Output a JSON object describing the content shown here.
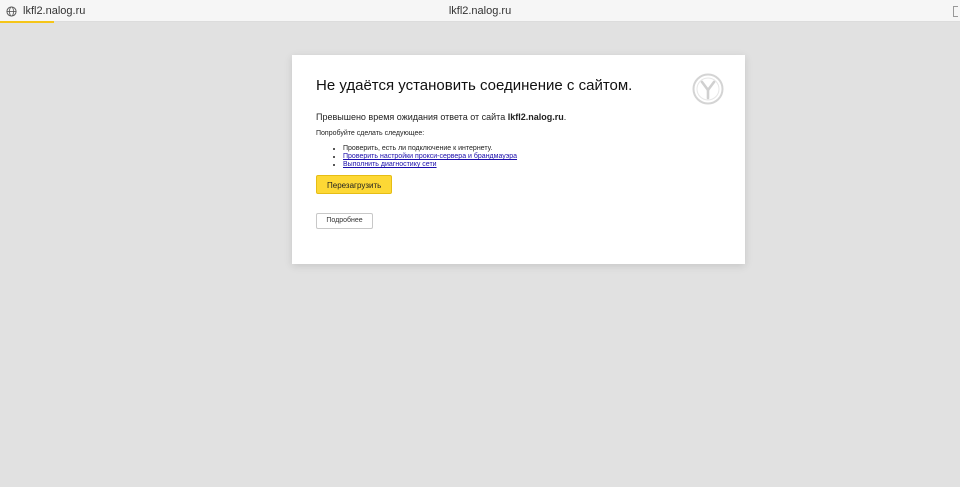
{
  "browser": {
    "tab_title": "lkfl2.nalog.ru",
    "page_title": "lkfl2.nalog.ru",
    "accent_color": "#f5c518"
  },
  "error": {
    "heading": "Не удаётся установить соединение с сайтом.",
    "message_prefix": "Превышено время ожидания ответа от сайта ",
    "host": "lkfl2.nalog.ru",
    "message_suffix": ".",
    "try_label": "Попробуйте сделать следующее:",
    "suggestions": [
      "Проверить, есть ли подключение к интернету.",
      "Проверить настройки прокси-сервера и брандмауэра",
      "Выполнить диагностику сети"
    ],
    "reload_label": "Перезагрузить",
    "details_label": "Подробнее",
    "button_color": "#fdd835",
    "link_color": "#1a0dab"
  },
  "icons": {
    "tab_icon": "globe-icon",
    "logo": "yandex-browser-logo"
  }
}
